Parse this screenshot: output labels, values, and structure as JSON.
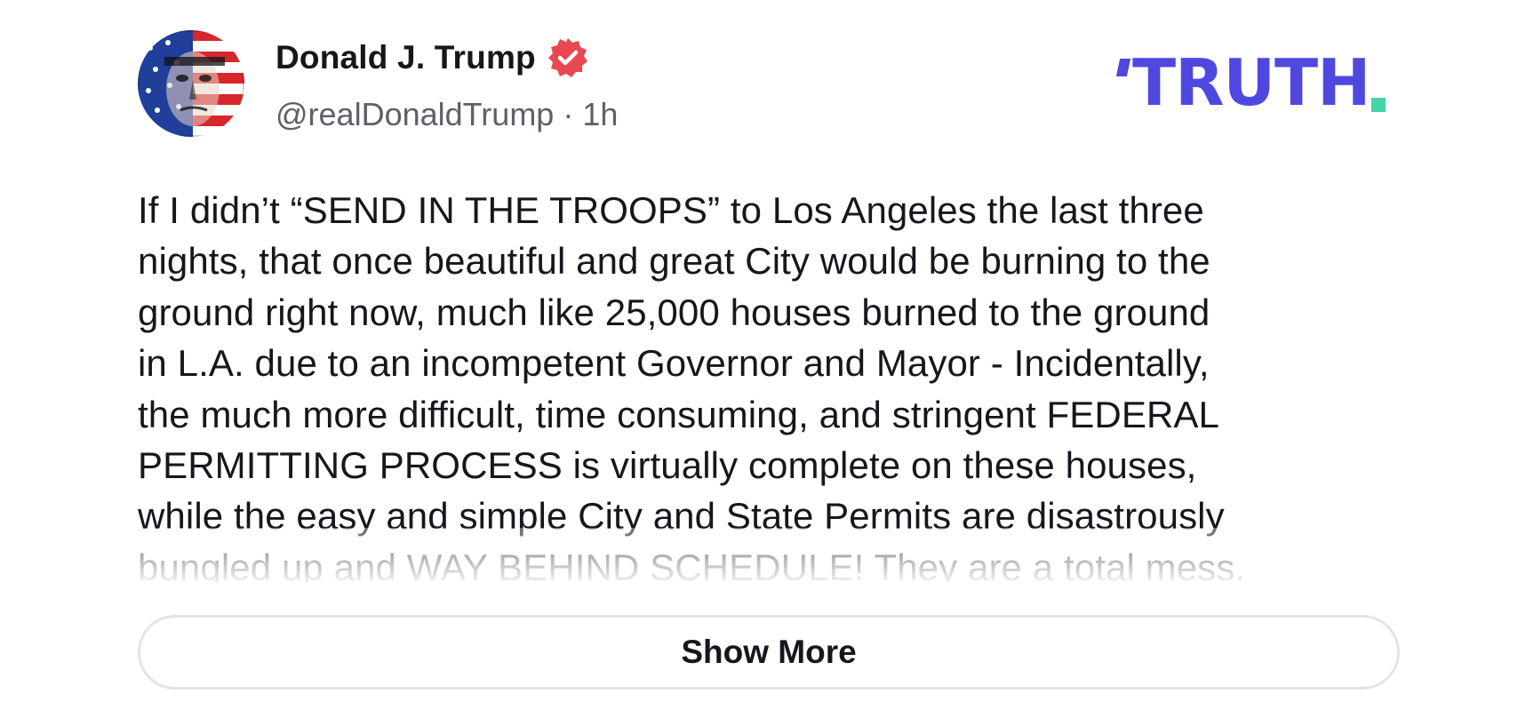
{
  "author": {
    "display_name": "Donald J. Trump",
    "verified": true,
    "verified_icon": "verified-badge-icon",
    "handle": "@realDonaldTrump",
    "separator": "·",
    "time_ago": "1h",
    "avatar_icon": "american-flag-portrait-avatar"
  },
  "brand": {
    "logo_text": "TRUTH",
    "primary_color": "#4f48e0",
    "accent_color": "#46d3a8"
  },
  "post": {
    "text": "If I didn’t “SEND IN THE TROOPS” to Los Angeles the last three\nnights, that once beautiful and great City would be burning to the\nground right now, much like 25,000 houses burned to the ground\nin L.A. due to an incompetent Governor and Mayor - Incidentally,\nthe much more difficult, time consuming, and stringent FEDERAL\nPERMITTING PROCESS is virtually complete on these houses,\nwhile the easy and simple City and State Permits are disastrously\nbungled up and WAY BEHIND SCHEDULE! They are a total mess."
  },
  "actions": {
    "show_more_label": "Show More"
  },
  "colors": {
    "verified_badge": "#e8484f",
    "text_primary": "#16171d",
    "text_secondary": "#5d606b",
    "button_border": "#e3e4e9"
  }
}
